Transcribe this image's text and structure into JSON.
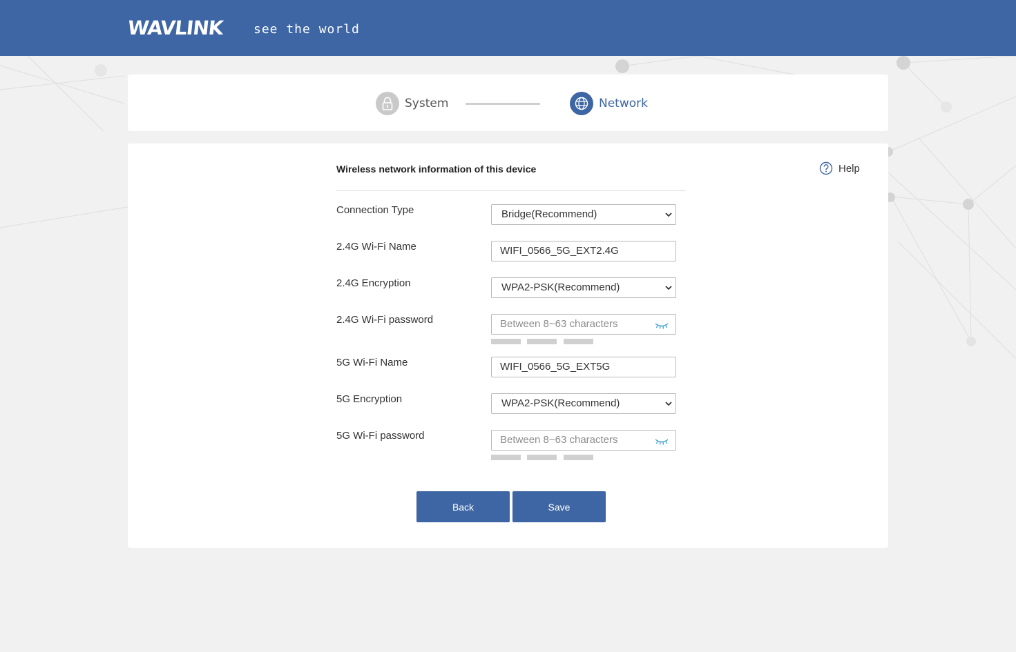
{
  "header": {
    "logo_text": "WAVLINK",
    "tagline": "see the world",
    "color": "#3e66a4"
  },
  "steps": [
    {
      "label": "System",
      "icon": "lock-icon",
      "active": false
    },
    {
      "label": "Network",
      "icon": "globe-icon",
      "active": true
    }
  ],
  "form": {
    "title": "Wireless network information of this device",
    "help_label": "Help",
    "connection_type": {
      "label": "Connection Type",
      "value": "Bridge(Recommend)"
    },
    "wifi24_name": {
      "label": "2.4G Wi-Fi Name",
      "value": "WIFI_0566_5G_EXT2.4G"
    },
    "wifi24_encryption": {
      "label": "2.4G Encryption",
      "value": "WPA2-PSK(Recommend)"
    },
    "wifi24_password": {
      "label": "2.4G Wi-Fi password",
      "placeholder": "Between 8~63 characters"
    },
    "wifi5_name": {
      "label": "5G Wi-Fi Name",
      "value": "WIFI_0566_5G_EXT5G"
    },
    "wifi5_encryption": {
      "label": "5G Encryption",
      "value": "WPA2-PSK(Recommend)"
    },
    "wifi5_password": {
      "label": "5G Wi-Fi password",
      "placeholder": "Between 8~63 characters"
    }
  },
  "buttons": {
    "back": "Back",
    "save": "Save"
  }
}
